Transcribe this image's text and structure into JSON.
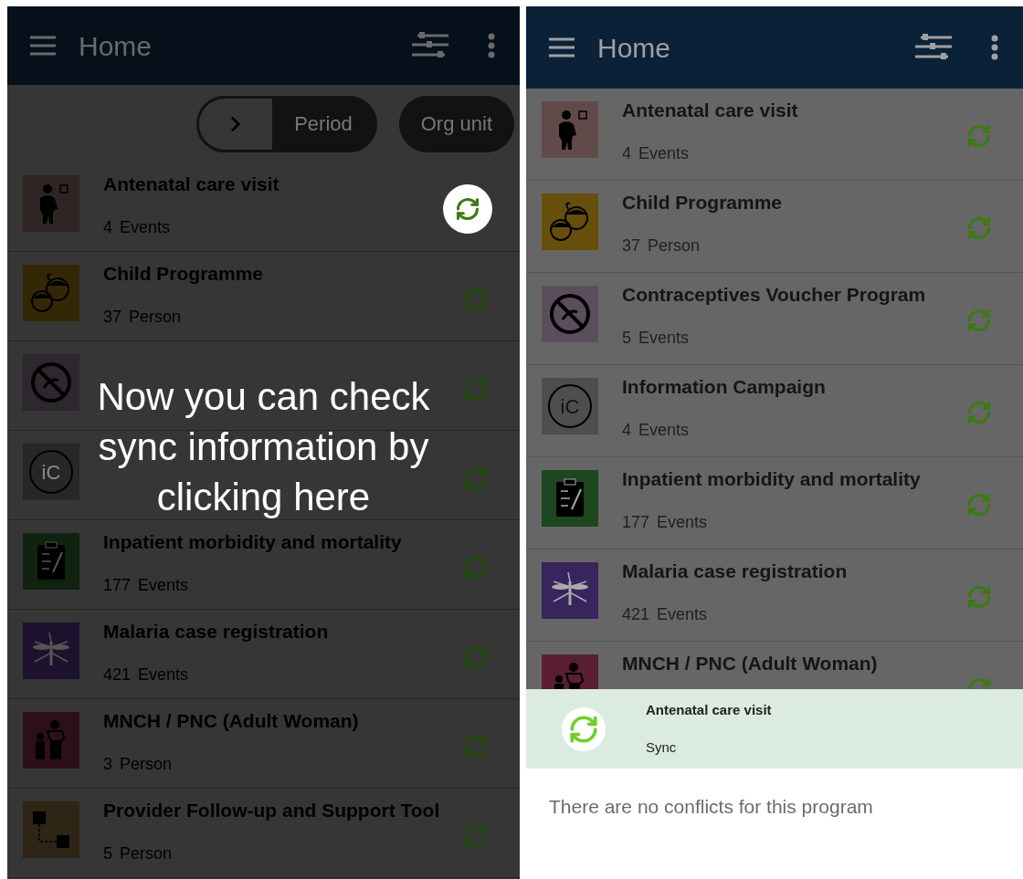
{
  "left_screen": {
    "header": {
      "title": "Home"
    },
    "filter_bar": {
      "chips": [
        {
          "kind": "toggle",
          "label": "Period"
        },
        {
          "kind": "pill",
          "label": "Org unit"
        }
      ]
    },
    "programs": [
      {
        "name": "Antenatal care visit",
        "count": "4",
        "unit": "Events",
        "color": "#302525",
        "highlighted": true
      },
      {
        "name": "Child Programme",
        "count": "37",
        "unit": "Person",
        "color": "#332706",
        "highlighted": false
      },
      {
        "color": "#2d272e",
        "highlighted": false
      },
      {
        "icon_label": "iC",
        "color": "#272727",
        "highlighted": false
      },
      {
        "name": "Inpatient morbidity and mortality",
        "count": "177",
        "unit": "Events",
        "color": "#0f2310",
        "highlighted": false
      },
      {
        "name": "Malaria case registration",
        "count": "421",
        "unit": "Events",
        "color": "#1c122e",
        "highlighted": false
      },
      {
        "name": "MNCH / PNC (Adult Woman)",
        "count": "3",
        "unit": "Person",
        "color": "#2d0f19",
        "highlighted": false
      },
      {
        "name": "Provider Follow-up and Support Tool",
        "count": "5",
        "unit": "Person",
        "color": "#2e2515",
        "highlighted": false
      }
    ],
    "tutorial": {
      "text": "Now you can check sync information by clicking here"
    }
  },
  "right_screen": {
    "header": {
      "title": "Home"
    },
    "programs": [
      {
        "name": "Antenatal care visit",
        "count": "4",
        "unit": "Events",
        "color": "#614a4a"
      },
      {
        "name": "Child Programme",
        "count": "37",
        "unit": "Person",
        "color": "#664e0c"
      },
      {
        "name": "Contraceptives Voucher Program",
        "count": "5",
        "unit": "Events",
        "color": "#5b4e5c"
      },
      {
        "name": "Information Campaign",
        "icon_label": "iC",
        "count": "4",
        "unit": "Events",
        "color": "#4e4e4e"
      },
      {
        "name": "Inpatient morbidity and mortality",
        "count": "177",
        "unit": "Events",
        "color": "#1e4620"
      },
      {
        "name": "Malaria case registration",
        "count": "421",
        "unit": "Events",
        "color": "#37255c"
      },
      {
        "name": "MNCH / PNC (Adult Woman)",
        "color": "#5a1e32"
      }
    ],
    "sync_sheet": {
      "program": "Antenatal care visit",
      "status": "Sync",
      "message": "There are no conflicts for this program"
    }
  }
}
